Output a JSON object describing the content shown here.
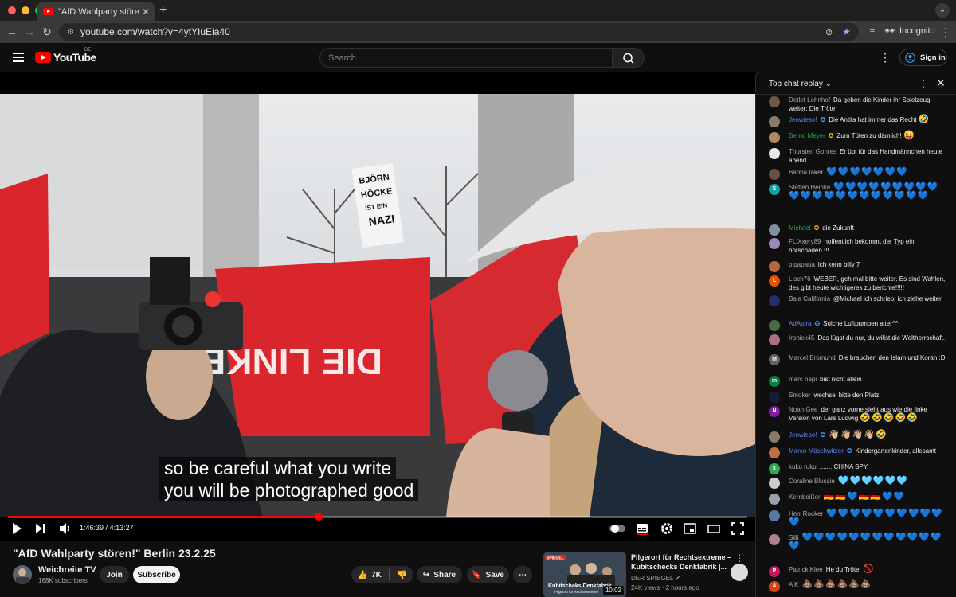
{
  "browser": {
    "tab_title": "\"AfD Wahlparty stören!\" Berli",
    "url": "youtube.com/watch?v=4ytYIuEia40",
    "incognito_label": "Incognito"
  },
  "youtube": {
    "logo_text": "YouTube",
    "country_code": "DE",
    "search_placeholder": "Search",
    "signin_label": "Sign in"
  },
  "video": {
    "caption_line1": "so be careful what you write",
    "caption_line2": "you will be photographed good",
    "current_time": "1:46:39",
    "time_separator": "/",
    "duration": "4:13:27",
    "progress_fraction": 0.42,
    "sign_text": [
      "BJÖRN",
      "HÖCKE",
      "IST EIN",
      "NAZI"
    ],
    "flag_text": "DIE LINKE"
  },
  "meta": {
    "title": "\"AfD Wahlparty stören!\" Berlin 23.2.25",
    "channel_name": "Weichreite TV",
    "subscribers": "168K subscribers",
    "join_label": "Join",
    "subscribe_label": "Subscribe",
    "like_count": "7K",
    "share_label": "Share",
    "save_label": "Save"
  },
  "recommended": {
    "title": "Pilgerort für Rechtsextreme – Kubitschecks Denkfabrik |...",
    "channel": "DER SPIEGEL",
    "views": "24K views",
    "age": "2 hours ago",
    "duration": "10:02",
    "thumb_badge": "SPIEGEL",
    "thumb_title": "Kubitscheks Denkfabrik",
    "thumb_subtitle": "Pilgerort für Rechtsextreme"
  },
  "chat": {
    "header": "Top chat replay",
    "messages": [
      {
        "author": "Detlef Lehnhof",
        "text": "Da geben die Kinder ihr Spielzeug weiter: Die Tröte.",
        "emoji": "",
        "avatar_color": "#6d5a4a",
        "avatar_letter": "",
        "author_type": "normal"
      },
      {
        "author": "Jenwieso!",
        "text": "Die Antifa hat immer das Recht",
        "emoji": "🤣",
        "avatar_color": "#8a7a6a",
        "avatar_letter": "",
        "author_type": "mod"
      },
      {
        "author": "Bernd Meyer",
        "text": "Zum Tüten zu dämlich!",
        "emoji": "😜",
        "avatar_color": "#b08a5a",
        "avatar_letter": "",
        "author_type": "mem"
      },
      {
        "author": "Thorsten Gohres",
        "text": "Er übt für das Handmännchen heute abend !",
        "emoji": "",
        "avatar_color": "#e8e8e8",
        "avatar_letter": "",
        "author_type": "normal"
      },
      {
        "author": "Babba taker",
        "text": "",
        "emoji": "💙💙💙💙💙💙💙",
        "avatar_color": "#6a5040",
        "avatar_letter": "",
        "author_type": "normal"
      },
      {
        "author": "Steffen Heinke",
        "text": "",
        "emoji": "💙💙💙💙💙💙💙💙💙💙💙💙💙💙💙💙💙💙💙💙💙",
        "avatar_color": "#12a4a4",
        "avatar_letter": "S",
        "author_type": "normal"
      },
      {
        "author": "Michael",
        "text": "die Zukunft",
        "emoji": "",
        "avatar_color": "#8090a0",
        "avatar_letter": "",
        "author_type": "mem"
      },
      {
        "author": "FLiXxery89",
        "text": "hoffentlich bekommt der Typ ein hörschaden !!!",
        "emoji": "",
        "avatar_color": "#9a8aba",
        "avatar_letter": "",
        "author_type": "normal"
      },
      {
        "author": "pipapaua",
        "text": "ich kenn billy 7",
        "emoji": "",
        "avatar_color": "#b06a3a",
        "avatar_letter": "",
        "author_type": "normal"
      },
      {
        "author": "Lisch76",
        "text": "WEBER, geh mal bitte weiter. Es sind Wahlen, des gibt heute wichtigeres zu berichte!!!!!",
        "emoji": "",
        "avatar_color": "#e65100",
        "avatar_letter": "L",
        "author_type": "normal"
      },
      {
        "author": "Baja California",
        "text": "@Michael ich schrieb, ich ziehe weiter",
        "emoji": "",
        "avatar_color": "#20306a",
        "avatar_letter": "",
        "author_type": "normal"
      },
      {
        "author": "AdAstra",
        "text": "Solche Luftpumpen alter^^",
        "emoji": "",
        "avatar_color": "#4a6a4a",
        "avatar_letter": "",
        "author_type": "mod"
      },
      {
        "author": "Ironick45",
        "text": "Das lügst du nur, du willst die Weltherrschaft.",
        "emoji": "",
        "avatar_color": "#aa7080",
        "avatar_letter": "",
        "author_type": "normal"
      },
      {
        "author": "Marcel Bromund",
        "text": "Die brauchen den Islam und Koran :D",
        "emoji": "",
        "avatar_color": "#5f6368",
        "avatar_letter": "M",
        "author_type": "normal"
      },
      {
        "author": "marc nepi",
        "text": "bist nicht allein",
        "emoji": "",
        "avatar_color": "#0b8043",
        "avatar_letter": "m",
        "author_type": "normal"
      },
      {
        "author": "Smoker",
        "text": "wechsel bitte den Platz",
        "emoji": "",
        "avatar_color": "#1a1a3a",
        "avatar_letter": "",
        "author_type": "normal"
      },
      {
        "author": "Noah Gee",
        "text": "der ganz vorne sieht aus wie die linke Version von Lars Ludwig",
        "emoji": "🤣🤣🤣🤣🤣",
        "avatar_color": "#7b1fa2",
        "avatar_letter": "N",
        "author_type": "normal"
      },
      {
        "author": "Jenwieso!",
        "text": "",
        "emoji": "👋🏼👋🏼👋🏼👋🏼🤣",
        "avatar_color": "#8a7a6a",
        "avatar_letter": "",
        "author_type": "mod"
      },
      {
        "author": "Marco Möschwitzer",
        "text": "Kindergartenkinder, allesamt",
        "emoji": "",
        "avatar_color": "#c07040",
        "avatar_letter": "",
        "author_type": "mod"
      },
      {
        "author": "kuku ruku",
        "text": "........CHINA SPY",
        "emoji": "",
        "avatar_color": "#33a852",
        "avatar_letter": "k",
        "author_type": "normal"
      },
      {
        "author": "Coraline Blussie",
        "text": "",
        "emoji": "🩵🩵🩵🩵🩵🩵",
        "avatar_color": "#ccc",
        "avatar_letter": "",
        "author_type": "normal"
      },
      {
        "author": "Kernbeißer",
        "text": "",
        "emoji": "🇩🇪🇩🇪💙🇩🇪🇩🇪💙💙",
        "avatar_color": "#9aa0a6",
        "avatar_letter": "",
        "author_type": "normal"
      },
      {
        "author": "Herr Rocker",
        "text": "",
        "emoji": "💙💙💙💙💙💙💙💙💙💙💙",
        "avatar_color": "#5a78a0",
        "avatar_letter": "",
        "author_type": "normal"
      },
      {
        "author": "Silli",
        "text": "",
        "emoji": "💙💙💙💙💙💙💙💙💙💙💙💙💙",
        "avatar_color": "#b08090",
        "avatar_letter": "",
        "author_type": "normal"
      },
      {
        "author": "Patrick Klee",
        "text": "He du Tröte!",
        "emoji": "🚫",
        "avatar_color": "#c2185b",
        "avatar_letter": "P",
        "author_type": "normal"
      },
      {
        "author": "A K",
        "text": "",
        "emoji": "💩💩💩💩💩💩",
        "avatar_color": "#d84315",
        "avatar_letter": "A",
        "author_type": "normal"
      }
    ]
  }
}
